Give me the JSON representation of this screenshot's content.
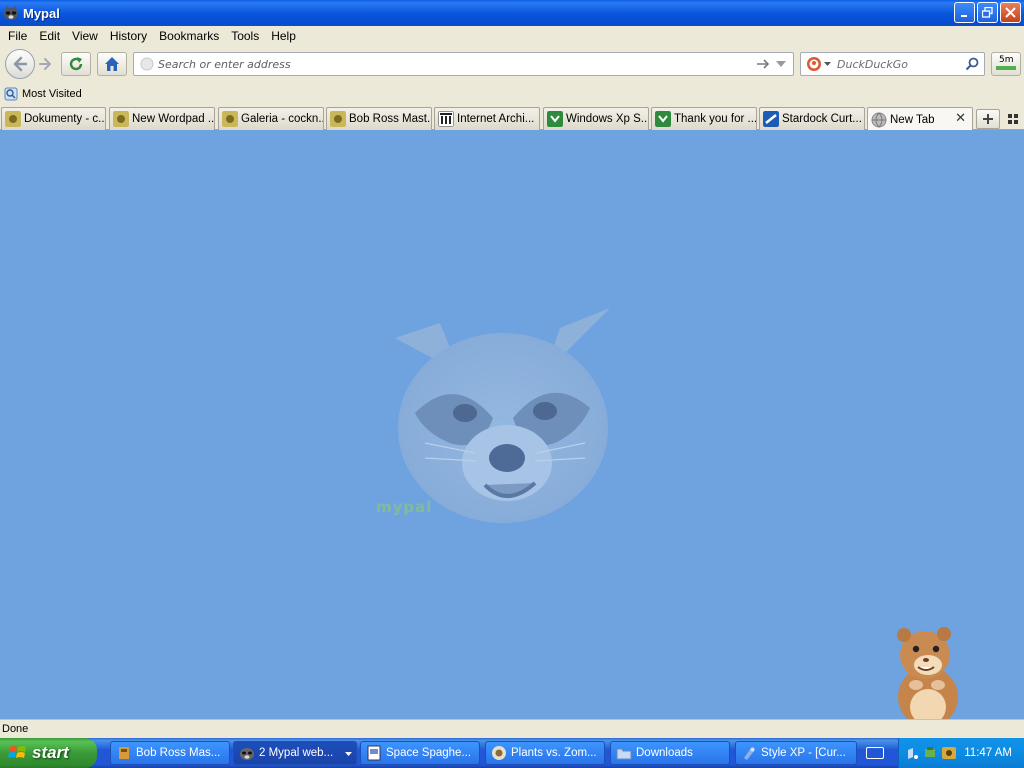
{
  "window": {
    "title": "Mypal"
  },
  "menu": [
    "File",
    "Edit",
    "View",
    "History",
    "Bookmarks",
    "Tools",
    "Help"
  ],
  "navbar": {
    "address_placeholder": "Search or enter address",
    "search_placeholder": "DuckDuckGo",
    "sm_badge": "5m"
  },
  "bookmarks": {
    "most_visited": "Most Visited"
  },
  "tabs": [
    {
      "label": "Dokumenty - c...",
      "icon": "image-icon"
    },
    {
      "label": "New Wordpad ...",
      "icon": "image-icon"
    },
    {
      "label": "Galeria - cockn...",
      "icon": "image-icon"
    },
    {
      "label": "Bob Ross Mast...",
      "icon": "image-icon"
    },
    {
      "label": "Internet Archi...",
      "icon": "archive-icon"
    },
    {
      "label": "Windows Xp S...",
      "icon": "green-arrow-icon"
    },
    {
      "label": "Thank you for ...",
      "icon": "green-arrow-icon"
    },
    {
      "label": "Stardock Curt...",
      "icon": "stardock-icon"
    },
    {
      "label": "New Tab",
      "icon": "globe-icon",
      "active": true
    }
  ],
  "content": {
    "logo_word": "mypal"
  },
  "status": {
    "text": "Done"
  },
  "taskbar": {
    "start_label": "start",
    "tasks": [
      {
        "label": "Bob Ross Mas...",
        "icon": "app-icon"
      },
      {
        "label": "2 Mypal web...",
        "icon": "raccoon-icon",
        "active": true
      },
      {
        "label": "Space Spaghe...",
        "icon": "document-icon"
      },
      {
        "label": "Plants vs. Zom...",
        "icon": "game-icon"
      },
      {
        "label": "Downloads",
        "icon": "folder-icon"
      },
      {
        "label": "Style XP - [Cur...",
        "icon": "style-icon"
      }
    ],
    "clock": "11:47 AM"
  }
}
